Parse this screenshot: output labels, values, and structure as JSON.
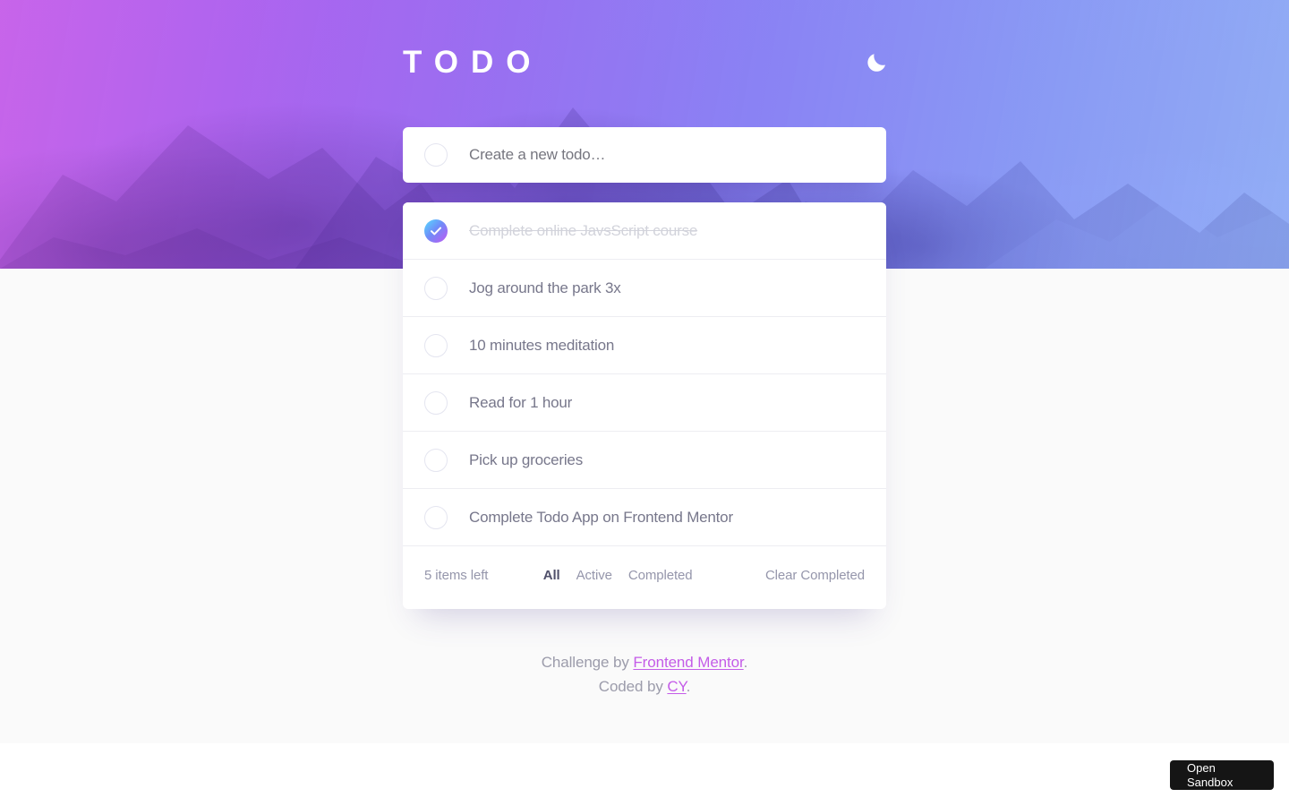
{
  "app": {
    "brand": "TODO",
    "theme_toggle_icon": "moon-icon",
    "accent_gradient_start": "#57ddff",
    "accent_gradient_end": "#c058f3",
    "hero_tint_start": "#c458ec",
    "hero_tint_end": "#648cf5",
    "page_background": "#fafafa"
  },
  "new_todo": {
    "value": "",
    "placeholder": "Create a new todo…"
  },
  "todos": [
    {
      "label": "Complete online JavsScript course",
      "completed": true
    },
    {
      "label": "Jog around the park 3x",
      "completed": false
    },
    {
      "label": "10 minutes meditation",
      "completed": false
    },
    {
      "label": "Read for 1 hour",
      "completed": false
    },
    {
      "label": "Pick up groceries",
      "completed": false
    },
    {
      "label": "Complete Todo App on Frontend Mentor",
      "completed": false
    }
  ],
  "footer": {
    "items_left": "5 items left",
    "filters": [
      {
        "label": "All",
        "active": true
      },
      {
        "label": "Active",
        "active": false
      },
      {
        "label": "Completed",
        "active": false
      }
    ],
    "clear_completed": "Clear Completed"
  },
  "attribution": {
    "line1_prefix": "Challenge by ",
    "line1_link": "Frontend Mentor",
    "line1_suffix": ".",
    "line2_prefix": "Coded by ",
    "line2_link": "CY",
    "line2_suffix": "."
  },
  "sandbox_button": {
    "line1": "Open",
    "line2": "Sandbox"
  }
}
